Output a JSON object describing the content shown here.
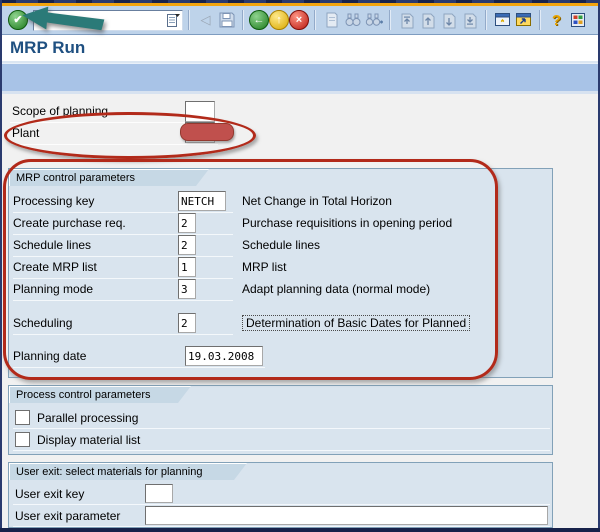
{
  "header": {
    "title": "MRP Run"
  },
  "toolbar": {
    "command_field_value": "",
    "icons": {
      "enter": "✔",
      "back_small": "◁",
      "back": "←",
      "exit": "↑",
      "cancel": "×",
      "help": "?"
    },
    "icon_names": [
      "enter",
      "command-field",
      "command-history",
      "back-arrow-small",
      "save",
      "back",
      "exit",
      "cancel",
      "print",
      "find",
      "find-next",
      "first-page",
      "previous-page",
      "next-page",
      "last-page",
      "new-session",
      "create-shortcut",
      "help",
      "customize-layout"
    ]
  },
  "top_fields": {
    "scope": {
      "label": "Scope of planning",
      "value": ""
    },
    "plant": {
      "label": "Plant",
      "value": ""
    }
  },
  "sections": {
    "mrp": {
      "title": "MRP control parameters",
      "rows": [
        {
          "label": "Processing key",
          "value": "NETCH",
          "desc": "Net Change in Total Horizon"
        },
        {
          "label": "Create purchase req.",
          "value": "2",
          "desc": "Purchase requisitions in opening period"
        },
        {
          "label": "Schedule lines",
          "value": "2",
          "desc": "Schedule lines"
        },
        {
          "label": "Create MRP list",
          "value": "1",
          "desc": "MRP list"
        },
        {
          "label": "Planning mode",
          "value": "3",
          "desc": "Adapt planning data (normal mode)"
        },
        {
          "label": "Scheduling",
          "value": "2",
          "desc": "Determination of Basic Dates for Planned"
        },
        {
          "label": "Planning date",
          "value": "19.03.2008",
          "desc": ""
        }
      ]
    },
    "process": {
      "title": "Process control parameters",
      "checkboxes": [
        {
          "label": "Parallel processing",
          "checked": false
        },
        {
          "label": "Display material list",
          "checked": false
        }
      ]
    },
    "user_exit": {
      "title": "User exit: select materials for planning",
      "rows": [
        {
          "label": "User exit key",
          "value": ""
        },
        {
          "label": "User exit parameter",
          "value": ""
        }
      ]
    }
  },
  "annotations": {
    "ellipse_color": "#b22a1a",
    "rect_color": "#b22a1a",
    "plant_highlight_fill": "#c0504d",
    "arrow_color": "#2b7a78"
  }
}
